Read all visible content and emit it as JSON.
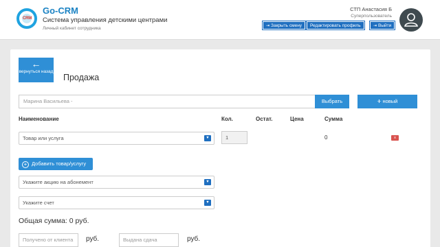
{
  "header": {
    "logo_text": "CRM",
    "app_name": "Go-CRM",
    "app_subtitle": "Система управления детскими центрами",
    "app_caption": "Личный кабинет сотрудника",
    "user_name": "СТП Анастасия Б",
    "user_role": "Суперпользователь",
    "close_shift": "Закрыть смену",
    "edit_profile": "Редактировать профиль",
    "logout": "Выйти"
  },
  "page": {
    "back_label": "вернуться назад",
    "title": "Продажа"
  },
  "client": {
    "value": "Марина Васильева -",
    "select_label": "Выбрать",
    "new_label": "новый"
  },
  "table": {
    "columns": [
      "Наименование",
      "Кол.",
      "Остат.",
      "Цена",
      "Сумма"
    ],
    "row": {
      "product_placeholder": "Товар или услуга",
      "qty": "1",
      "sum": "0",
      "delete": "x"
    }
  },
  "add_item_label": "Добавить товар/услугу",
  "promo_placeholder": "Укажите акцию на абонемент",
  "account_placeholder": "Укажите счет",
  "total_text": "Общая сумма: 0 руб.",
  "received_placeholder": "Получено от клиента",
  "change_placeholder": "Выдана сдача",
  "currency": "руб.",
  "colors": {
    "primary": "#2f8fd6",
    "header_button": "#1f6fc0",
    "brand": "#1a82c3",
    "danger": "#d9534f"
  }
}
